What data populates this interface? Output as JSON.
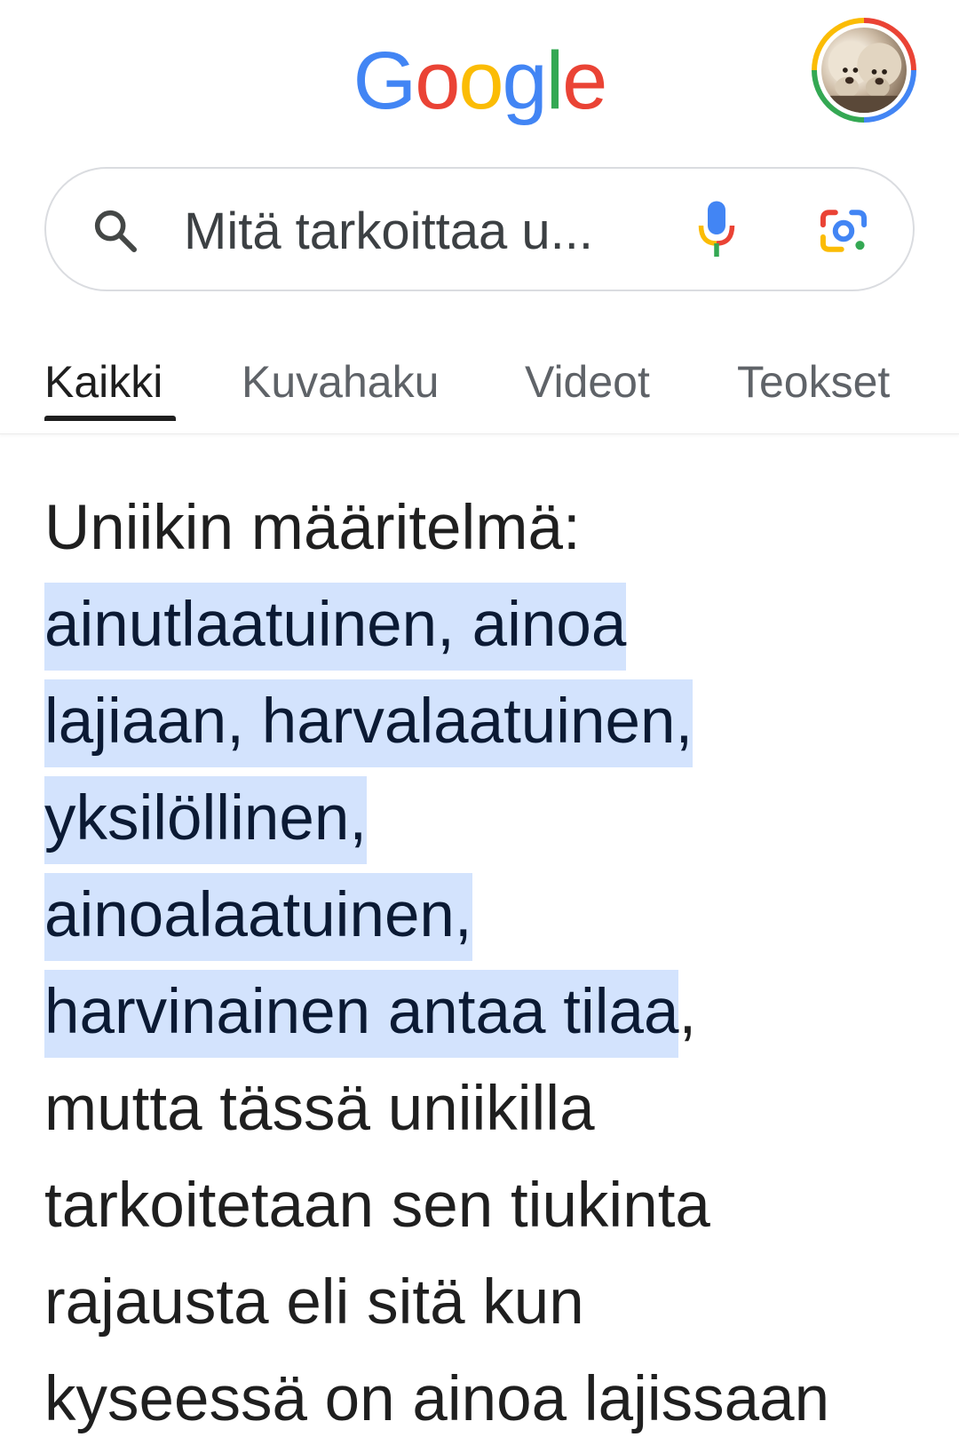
{
  "header": {
    "logo_letters": [
      "G",
      "o",
      "o",
      "g",
      "l",
      "e"
    ],
    "logo_colors": [
      "#4285f4",
      "#ea4335",
      "#fbbc05",
      "#4285f4",
      "#34a853",
      "#ea4335"
    ]
  },
  "search": {
    "query": "Mitä tarkoittaa u...",
    "icons": [
      "search-icon",
      "mic-icon",
      "google-lens-icon"
    ]
  },
  "tabs": [
    {
      "label": "Kaikki",
      "active": true
    },
    {
      "label": "Kuvahaku",
      "active": false
    },
    {
      "label": "Videot",
      "active": false
    },
    {
      "label": "Teokset",
      "active": false
    }
  ],
  "result": {
    "lines": [
      {
        "text": "Uniikin määritelmä:",
        "highlight": false
      },
      {
        "text": "ainutlaatuinen, ainoa",
        "highlight": true
      },
      {
        "text": "lajiaan, harvalaatuinen,",
        "highlight": true
      },
      {
        "text": "yksilöllinen,",
        "highlight": true
      },
      {
        "text": "ainoalaatuinen,",
        "highlight": true
      },
      {
        "text": "harvinainen antaa tilaa",
        "highlight": true,
        "suffix": ","
      },
      {
        "text": "mutta tässä uniikilla",
        "highlight": false
      },
      {
        "text": "tarkoitetaan sen tiukinta",
        "highlight": false
      },
      {
        "text": "rajausta eli sitä kun",
        "highlight": false
      },
      {
        "text": "kyseessä on ainoa lajissaan",
        "highlight": false
      }
    ]
  },
  "colors": {
    "highlight": "#d3e3fd",
    "text": "#1f1f1f",
    "muted": "#5f6368"
  }
}
